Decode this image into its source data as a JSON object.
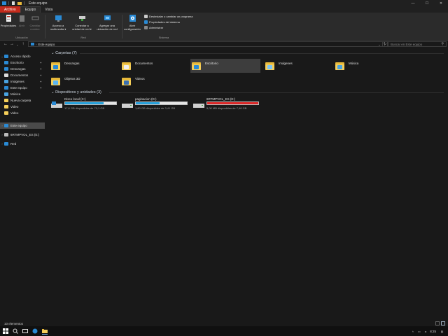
{
  "window": {
    "title": "Este equipo",
    "controls": {
      "minimize": "—",
      "maximize": "☐",
      "close": "✕"
    }
  },
  "ribbon": {
    "tabs": [
      {
        "label": "Archivo"
      },
      {
        "label": "Equipo"
      },
      {
        "label": "Vista"
      }
    ],
    "groups": [
      {
        "label": "Ubicación"
      },
      {
        "label": "Red"
      },
      {
        "label": "Sistema"
      }
    ],
    "buttons": {
      "propiedades": "Propiedades",
      "abrir": "Abrir",
      "cambiar_nombre": "Cambiar\nnombre",
      "acceso_multimedia": "Acceso a\nmultimedia ▾",
      "conectar_unidad": "Conectar a\nunidad de red ▾",
      "agregar_ubicacion": "Agregar una\nubicación de red",
      "abrir_configuracion": "Abrir\nconfiguración",
      "desinstalar": "Desinstalar o cambiar un programa",
      "propiedades_sistema": "Propiedades del sistema",
      "administrar": "Administrar"
    }
  },
  "address": {
    "path": "Este equipo",
    "search_placeholder": "Buscar en Este equipo",
    "back": "←",
    "forward": "→",
    "dropdown": "⌄",
    "up": "↑",
    "refresh": "↻",
    "mag": "⚲"
  },
  "nav": {
    "quick_access": "Acceso rápido",
    "items": [
      {
        "label": "Escritorio"
      },
      {
        "label": "Descargas"
      },
      {
        "label": "Documentos"
      },
      {
        "label": "Imágenes"
      },
      {
        "label": "Este equipo"
      },
      {
        "label": "Música"
      },
      {
        "label": "Nueva carpeta"
      },
      {
        "label": "Video"
      },
      {
        "label": "Video"
      }
    ],
    "this_pc": "Este equipo",
    "usb": "6RTMPVOL_ES (E:)",
    "network": "Red",
    "pin": "📌"
  },
  "content": {
    "folders_header": "Carpetas (7)",
    "folders": [
      {
        "name": "Descargas"
      },
      {
        "name": "Documentos"
      },
      {
        "name": "Escritorio"
      },
      {
        "name": "Imágenes"
      },
      {
        "name": "Música"
      },
      {
        "name": "Objetos 3D"
      },
      {
        "name": "Videos"
      }
    ],
    "drives_header": "Dispositivos y unidades (3)",
    "drives": [
      {
        "name": "Disco local (C:)",
        "info": "17,6 GB disponibles de 70,1 GB",
        "used_fraction": 0.75,
        "color": "#26a0da"
      },
      {
        "name": "paginacion (D:)",
        "info": "1,80 GB disponibles de 3,41 GB",
        "used_fraction": 0.47,
        "color": "#26a0da"
      },
      {
        "name": "6RTMPVOL_ES (E:)",
        "info": "5,00 MB disponibles de 7,46 GB",
        "used_fraction": 1.0,
        "color": "#da2626"
      }
    ]
  },
  "status": {
    "items": "10 elementos"
  },
  "taskbar": {
    "time": "8:25"
  },
  "colors": {
    "accent": "#2a8ad4",
    "file_tab": "#c42b1c",
    "folder": "#f5cf5a",
    "bar_ok": "#26a0da",
    "bar_full": "#da2626"
  }
}
